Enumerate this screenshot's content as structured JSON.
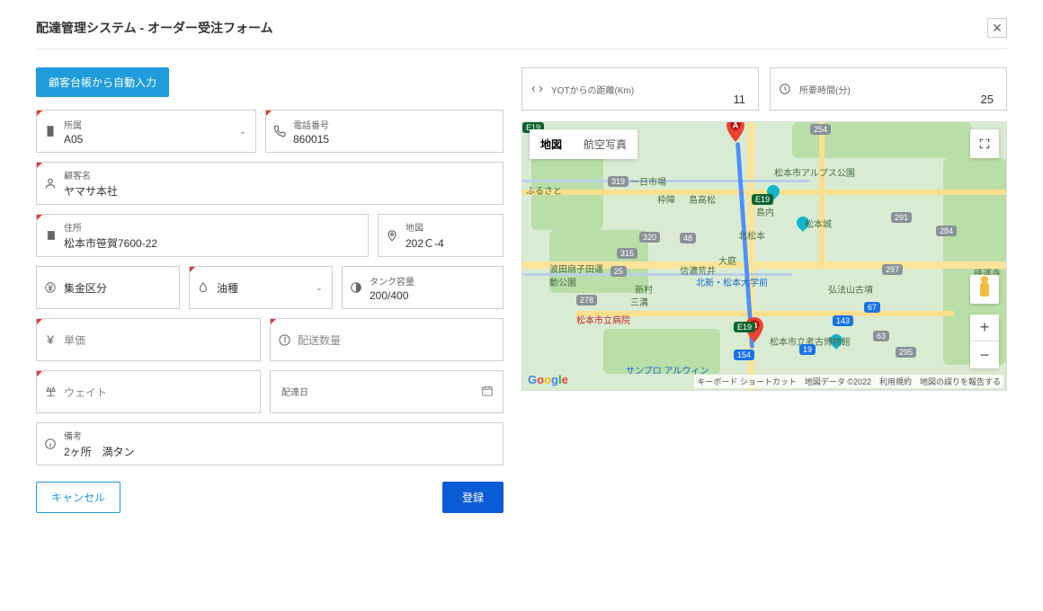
{
  "header": {
    "title": "配達管理システム - オーダー受注フォーム"
  },
  "buttons": {
    "autoFill": "顧客台帳から自動入力",
    "cancel": "キャンセル",
    "submit": "登録"
  },
  "fields": {
    "affiliation": {
      "label": "所属",
      "value": "A05"
    },
    "phone": {
      "label": "電話番号",
      "value": "860015"
    },
    "customer": {
      "label": "顧客名",
      "value": "ヤマサ本社"
    },
    "address": {
      "label": "住所",
      "value": "松本市笹賀7600-22"
    },
    "mapCode": {
      "label": "地図",
      "value": "202Ｃ-4"
    },
    "collectType": {
      "label": "集金区分",
      "value": ""
    },
    "oilType": {
      "label": "油種",
      "value": ""
    },
    "tankCapacity": {
      "label": "タンク容量",
      "value": "200/400"
    },
    "unitPrice": {
      "label": "単価",
      "value": ""
    },
    "quantity": {
      "label": "配送数量",
      "value": ""
    },
    "weight": {
      "label": "ウェイト",
      "value": ""
    },
    "deliveryDate": {
      "label": "配達日",
      "value": ""
    },
    "remarks": {
      "label": "備考",
      "value": "2ヶ所　満タン"
    }
  },
  "stats": {
    "distance": {
      "label": "YOTからの距離(Km)",
      "value": "11"
    },
    "time": {
      "label": "所要時間(分)",
      "value": "25"
    }
  },
  "map": {
    "typeMap": "地図",
    "typeSat": "航空写真",
    "attribution": "キーボード ショートカット　地図データ ©2022　利用規約　地図の誤りを報告する",
    "pois": {
      "p1": "一日市場",
      "p2": "枠障",
      "p3": "島高松",
      "p4": "島内",
      "p5": "北松本",
      "p6": "松本城",
      "p7": "松本市アルプス公園",
      "p8": "大庭",
      "p9": "信濃荒井",
      "p10": "波田扇子田運動公園",
      "p11": "新村",
      "p12": "三溝",
      "p13": "北新・松本大学前",
      "p14": "弘法山古墳",
      "p15": "徳運寺",
      "p16": "松本市立病院",
      "p17": "松本市立考古博物館",
      "p18": "サンプロ アルウィン",
      "p19": "ふるさと"
    },
    "shields": {
      "s254": "254",
      "s319": "319",
      "s320": "320",
      "s48": "48",
      "s315": "315",
      "s25": "25",
      "s278": "278",
      "s291": "291",
      "s284": "284",
      "s297": "297",
      "s63": "63",
      "s295": "295",
      "se19a": "E19",
      "se19b": "E19",
      "s19": "19",
      "s143": "143",
      "s67": "67",
      "s154": "154"
    }
  }
}
